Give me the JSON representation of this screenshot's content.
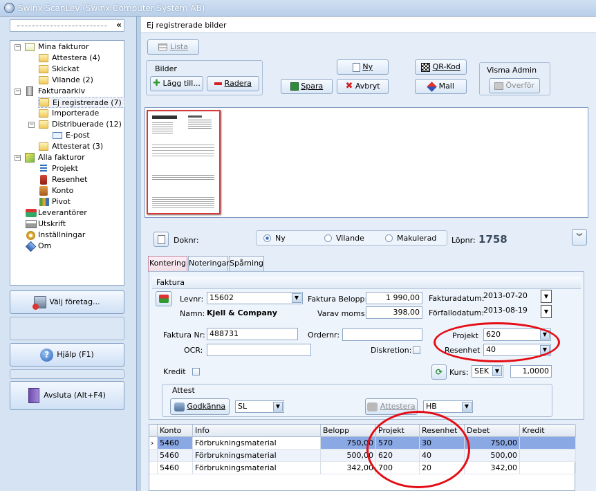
{
  "window": {
    "title": "Swinx ScanLev (Swinx Computer System AB)"
  },
  "left": {
    "collapse_glyph": "«",
    "tree": [
      {
        "label": "Mina fakturor",
        "icon": "invoice-check-icon"
      },
      {
        "label": "Attestera (4)",
        "icon": "folder-icon"
      },
      {
        "label": "Skickat",
        "icon": "folder-icon"
      },
      {
        "label": "Vilande (2)",
        "icon": "folder-icon"
      },
      {
        "label": "Fakturaarkiv",
        "icon": "archive-icon"
      },
      {
        "label": "Ej registrerade (7)",
        "icon": "folder-open-icon"
      },
      {
        "label": "Importerade",
        "icon": "folder-icon"
      },
      {
        "label": "Distribuerade (12)",
        "icon": "folder-icon"
      },
      {
        "label": "E-post",
        "icon": "email-icon"
      },
      {
        "label": "Attesterat (3)",
        "icon": "folder-icon"
      },
      {
        "label": "Alla fakturor",
        "icon": "all-invoices-icon"
      },
      {
        "label": "Projekt",
        "icon": "project-icon"
      },
      {
        "label": "Resenhet",
        "icon": "cost-unit-icon"
      },
      {
        "label": "Konto",
        "icon": "account-icon"
      },
      {
        "label": "Pivot",
        "icon": "pivot-icon"
      },
      {
        "label": "Leverantörer",
        "icon": "suppliers-icon"
      },
      {
        "label": "Utskrift",
        "icon": "printer-icon"
      },
      {
        "label": "Inställningar",
        "icon": "settings-icon"
      },
      {
        "label": "Om",
        "icon": "info-icon"
      }
    ],
    "buttons": {
      "company": "Välj företag...",
      "help": "Hjälp (F1)",
      "exit": "Avsluta (Alt+F4)"
    }
  },
  "main": {
    "header": "Ej registrerade bilder",
    "toolbar": {
      "lista": "Lista",
      "bilder_group": "Bilder",
      "add": "Lägg till...",
      "remove": "Radera",
      "save": "Spara",
      "new": "Ny",
      "cancel": "Avbryt",
      "qr": "QR-Kod",
      "template": "Mall",
      "visma_group": "Visma Admin",
      "transfer": "Överför"
    },
    "doc": {
      "doknr_label": "Doknr:",
      "status_options": [
        "Ny",
        "Vilande",
        "Makulerad"
      ],
      "status_selected": "Ny",
      "lopnr_label": "Löpnr:",
      "lopnr": "1758"
    },
    "tabs": [
      "Kontering",
      "Noteringar",
      "Spårning"
    ],
    "active_tab": "Kontering",
    "faktura": {
      "section": "Faktura",
      "levnr_label": "Levnr:",
      "levnr": "15602",
      "namn_label": "Namn:",
      "namn": "Kjell & Company",
      "belopp_label": "Faktura Belopp:",
      "belopp": "1 990,00",
      "moms_label": "Varav moms:",
      "moms": "398,00",
      "fakturadatum_label": "Fakturadatum:",
      "fakturadatum": "2013-07-20",
      "forfallodatum_label": "Förfallodatum:",
      "forfallodatum": "2013-08-19",
      "fakturanr_label": "Faktura Nr:",
      "fakturanr": "488731",
      "ordernr_label": "Ordernr:",
      "ordernr": "",
      "ocr_label": "OCR:",
      "ocr": "",
      "diskretion_label": "Diskretion:",
      "projekt_label": "Projekt",
      "projekt": "620",
      "resenhet_label": "Resenhet",
      "resenhet": "40",
      "kredit_label": "Kredit",
      "kurs_label": "Kurs:",
      "currency": "SEK",
      "kurs": "1,0000"
    },
    "attest": {
      "section": "Attest",
      "approve": "Godkänna",
      "approver": "SL",
      "attestera": "Attestera",
      "attester": "HB"
    },
    "grid": {
      "columns": [
        "Konto",
        "Info",
        "Belopp",
        "Projekt",
        "Resenhet",
        "Debet",
        "Kredit"
      ],
      "rows": [
        {
          "konto": "5460",
          "info": "Förbrukningsmaterial",
          "belopp": "750,00",
          "projekt": "570",
          "resenhet": "30",
          "debet": "750,00",
          "kredit": ""
        },
        {
          "konto": "5460",
          "info": "Förbrukningsmaterial",
          "belopp": "500,00",
          "projekt": "620",
          "resenhet": "40",
          "debet": "500,00",
          "kredit": ""
        },
        {
          "konto": "5460",
          "info": "Förbrukningsmaterial",
          "belopp": "342,00",
          "projekt": "700",
          "resenhet": "20",
          "debet": "342,00",
          "kredit": ""
        }
      ]
    }
  },
  "colors": {
    "highlight_oval": "#e40d15",
    "selected_row": "#8aa8e3",
    "active_tab": "#f3dce6"
  }
}
